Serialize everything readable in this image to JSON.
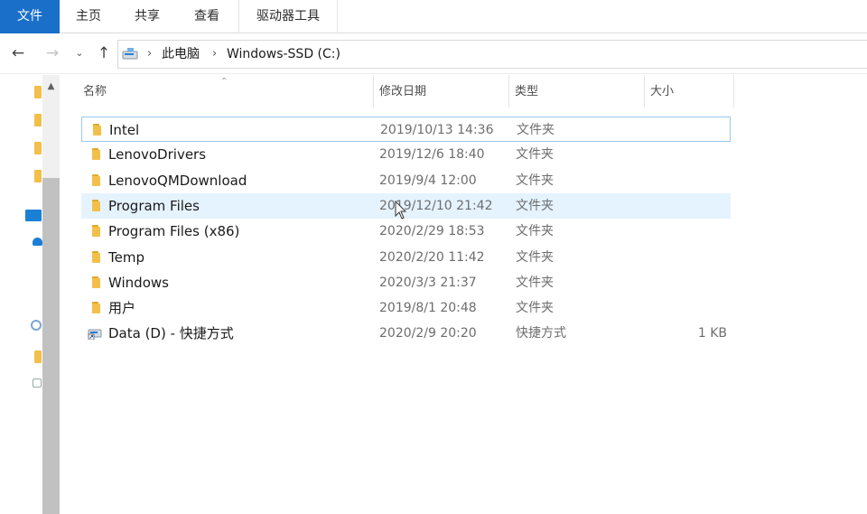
{
  "ribbon": {
    "tabs": [
      "文件",
      "主页",
      "共享",
      "查看",
      "驱动器工具"
    ]
  },
  "navigation": {
    "back_icon": "arrow-left-icon",
    "forward_icon": "arrow-right-icon",
    "recent_icon": "chevron-down-icon",
    "up_icon": "arrow-up-icon"
  },
  "address": {
    "icon": "drive-icon",
    "breadcrumb": [
      "此电脑",
      "Windows-SSD (C:)"
    ]
  },
  "columns": {
    "name": "名称",
    "date": "修改日期",
    "type": "类型",
    "size": "大小"
  },
  "files": [
    {
      "name": "Intel",
      "date": "2019/10/13 14:36",
      "type": "文件夹",
      "size": "",
      "icon": "folder-icon"
    },
    {
      "name": "LenovoDrivers",
      "date": "2019/12/6 18:40",
      "type": "文件夹",
      "size": "",
      "icon": "folder-icon"
    },
    {
      "name": "LenovoQMDownload",
      "date": "2019/9/4 12:00",
      "type": "文件夹",
      "size": "",
      "icon": "folder-icon"
    },
    {
      "name": "Program Files",
      "date": "2019/12/10 21:42",
      "type": "文件夹",
      "size": "",
      "icon": "folder-icon"
    },
    {
      "name": "Program Files (x86)",
      "date": "2020/2/29 18:53",
      "type": "文件夹",
      "size": "",
      "icon": "folder-icon"
    },
    {
      "name": "Temp",
      "date": "2020/2/20 11:42",
      "type": "文件夹",
      "size": "",
      "icon": "folder-icon"
    },
    {
      "name": "Windows",
      "date": "2020/3/3 21:37",
      "type": "文件夹",
      "size": "",
      "icon": "folder-icon"
    },
    {
      "name": "用户",
      "date": "2019/8/1 20:48",
      "type": "文件夹",
      "size": "",
      "icon": "folder-icon"
    },
    {
      "name": "Data (D) - 快捷方式",
      "date": "2020/2/9 20:20",
      "type": "快捷方式",
      "size": "1 KB",
      "icon": "shortcut-icon"
    }
  ],
  "state": {
    "focused_row": "Intel",
    "hovered_row": "Program Files"
  },
  "colors": {
    "accent": "#1a6fc9",
    "folder": "#f2c04a",
    "hover": "#e5f3ff",
    "focus_border": "#99c9ef"
  }
}
